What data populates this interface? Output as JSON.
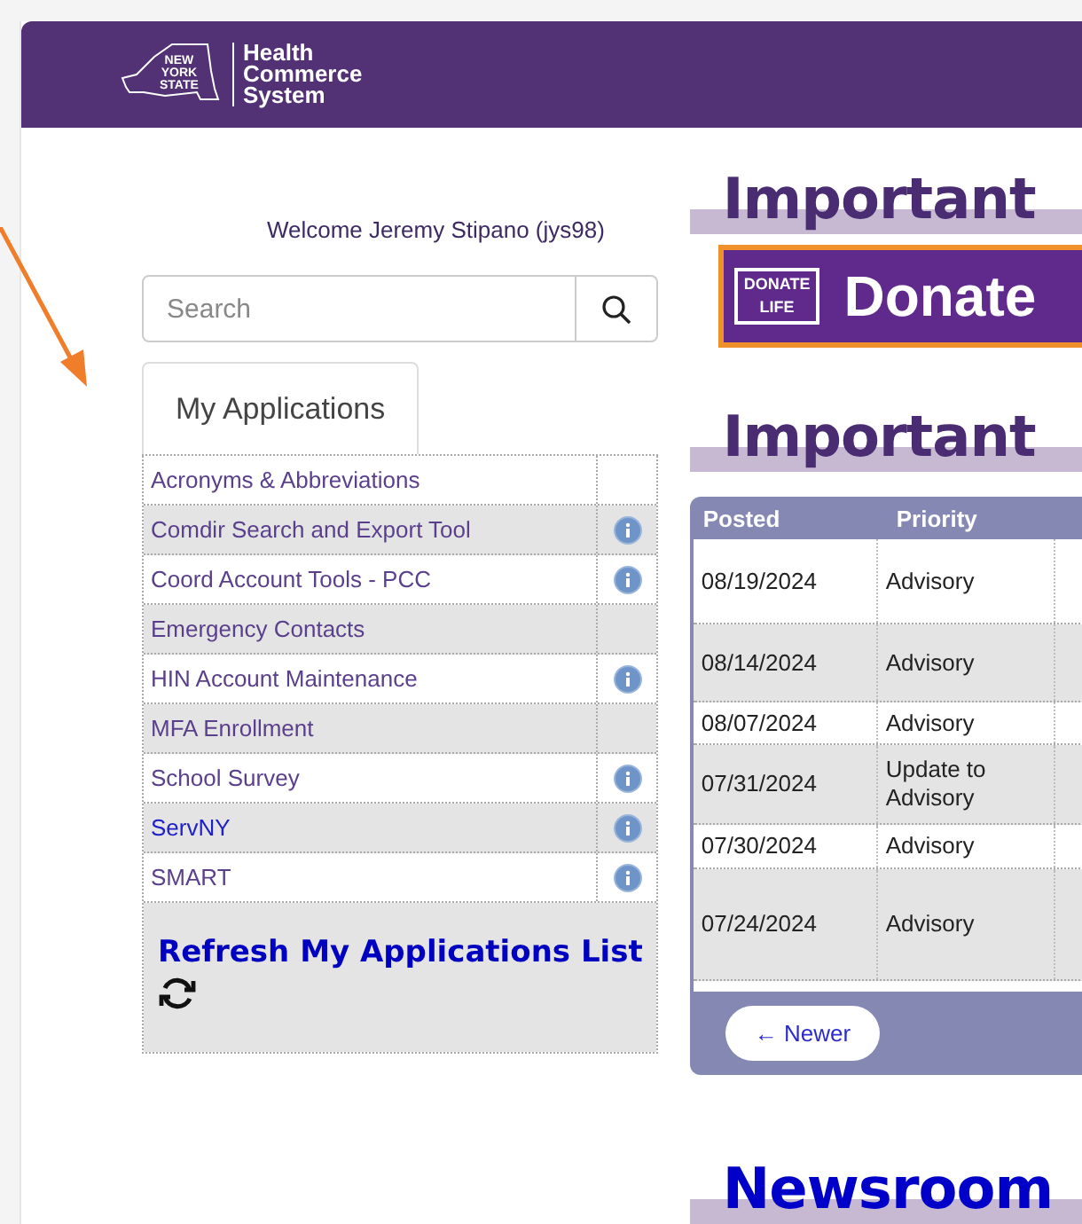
{
  "header": {
    "logo_state": [
      "NEW",
      "YORK",
      "STATE"
    ],
    "logo_title": [
      "Health",
      "Commerce",
      "System"
    ]
  },
  "welcome": "Welcome Jeremy Stipano (jys98)",
  "search": {
    "placeholder": "Search"
  },
  "tabs": [
    {
      "label": "My Applications",
      "selected": true
    }
  ],
  "applications": [
    {
      "name": "Acronyms & Abbreviations",
      "info": false,
      "visited": true
    },
    {
      "name": "Comdir Search and Export Tool",
      "info": true,
      "visited": true
    },
    {
      "name": "Coord Account Tools - PCC",
      "info": true,
      "visited": true
    },
    {
      "name": "Emergency Contacts",
      "info": false,
      "visited": true
    },
    {
      "name": "HIN Account Maintenance",
      "info": true,
      "visited": true
    },
    {
      "name": "MFA Enrollment",
      "info": false,
      "visited": true
    },
    {
      "name": "School Survey",
      "info": true,
      "visited": true
    },
    {
      "name": "ServNY",
      "info": true,
      "visited": false
    },
    {
      "name": "SMART",
      "info": true,
      "visited": true
    }
  ],
  "refresh": "Refresh My Applications List",
  "sections": [
    {
      "kind": "heading",
      "text": "Important"
    },
    {
      "kind": "banner",
      "badge": [
        "DONATE",
        "LIFE"
      ],
      "text": "Donate"
    },
    {
      "kind": "heading",
      "text": "Important"
    }
  ],
  "table": {
    "columns": [
      "Posted",
      "Priority"
    ],
    "rows": [
      [
        "08/19/2024",
        "Advisory"
      ],
      [
        "08/14/2024",
        "Advisory"
      ],
      [
        "08/07/2024",
        "Advisory"
      ],
      [
        "07/31/2024",
        "Update to Advisory"
      ],
      [
        "07/30/2024",
        "Advisory"
      ],
      [
        "07/24/2024",
        "Advisory"
      ]
    ],
    "pager": "← Newer"
  },
  "newsroom": "Newsroom"
}
